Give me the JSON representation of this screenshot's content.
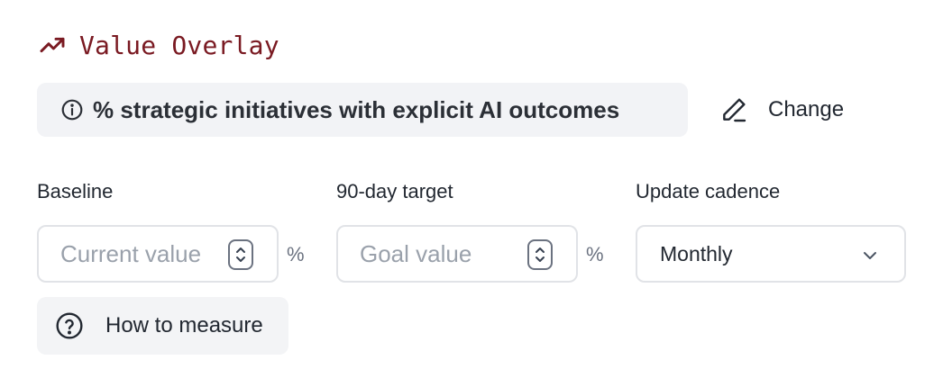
{
  "header": {
    "title": "Value Overlay",
    "icon": "trending-up-icon",
    "accent_color": "#7a1a22"
  },
  "metric": {
    "label": "% strategic initiatives with explicit AI outcomes",
    "icon": "info-icon"
  },
  "change_button": {
    "label": "Change",
    "icon": "pencil-icon"
  },
  "fields": {
    "baseline": {
      "label": "Baseline",
      "placeholder": "Current value",
      "unit": "%"
    },
    "target": {
      "label": "90-day target",
      "placeholder": "Goal value",
      "unit": "%"
    },
    "cadence": {
      "label": "Update cadence",
      "selected": "Monthly"
    }
  },
  "help_button": {
    "label": "How to measure",
    "icon": "question-circle-icon"
  }
}
